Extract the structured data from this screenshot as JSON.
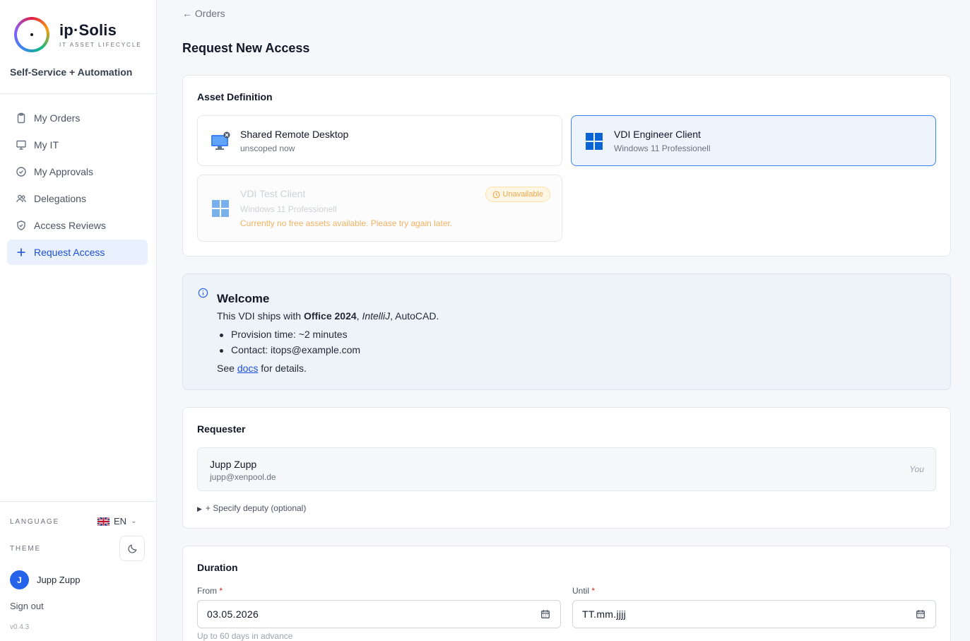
{
  "sidebar": {
    "logo_name": "ip·Solis",
    "logo_tagline": "IT ASSET LIFECYCLE",
    "subtitle": "Self-Service + Automation",
    "items": [
      {
        "label": "My Orders",
        "icon": "clipboard-icon"
      },
      {
        "label": "My IT",
        "icon": "monitor-icon"
      },
      {
        "label": "My Approvals",
        "icon": "check-circle-icon"
      },
      {
        "label": "Delegations",
        "icon": "users-icon"
      },
      {
        "label": "Access Reviews",
        "icon": "shield-check-icon"
      },
      {
        "label": "Request Access",
        "icon": "plus-icon",
        "active": true
      }
    ],
    "language_label": "LANGUAGE",
    "language_value": "EN",
    "theme_label": "THEME",
    "user_initial": "J",
    "user_name": "Jupp Zupp",
    "sign_out": "Sign out",
    "version": "v0.4.3"
  },
  "main": {
    "back_link": "← Orders",
    "page_title": "Request New Access",
    "asset_definition": {
      "title": "Asset Definition",
      "assets": [
        {
          "name": "Shared Remote Desktop",
          "sub": "unscoped now",
          "icon": "remote-desktop-icon"
        },
        {
          "name": "VDI Engineer Client",
          "sub": "Windows 11 Professionell",
          "icon": "windows-icon",
          "selected": true
        },
        {
          "name": "VDI Test Client",
          "sub": "Windows 11 Professionell",
          "icon": "windows-icon",
          "badge": "Unavailable",
          "message": "Currently no free assets available. Please try again later."
        }
      ]
    },
    "welcome": {
      "title": "Welcome",
      "line_prefix": "This VDI ships with ",
      "line_bold": "Office 2024",
      "line_sep1": ", ",
      "line_italic": "IntelliJ",
      "line_rest": ", AutoCAD.",
      "bullets": [
        "Provision time: ~2 minutes",
        "Contact: itops@example.com"
      ],
      "see_prefix": "See ",
      "see_link": "docs",
      "see_suffix": " for details."
    },
    "requester": {
      "title": "Requester",
      "name": "Jupp Zupp",
      "email": "jupp@xenpool.de",
      "you": "You",
      "deputy": "+ Specify deputy (optional)"
    },
    "duration": {
      "title": "Duration",
      "from_label": "From",
      "from_value": "03.05.2026",
      "until_label": "Until",
      "until_value": "TT.mm.jjjj",
      "required_mark": "*",
      "hint": "Up to 60 days in advance"
    }
  }
}
